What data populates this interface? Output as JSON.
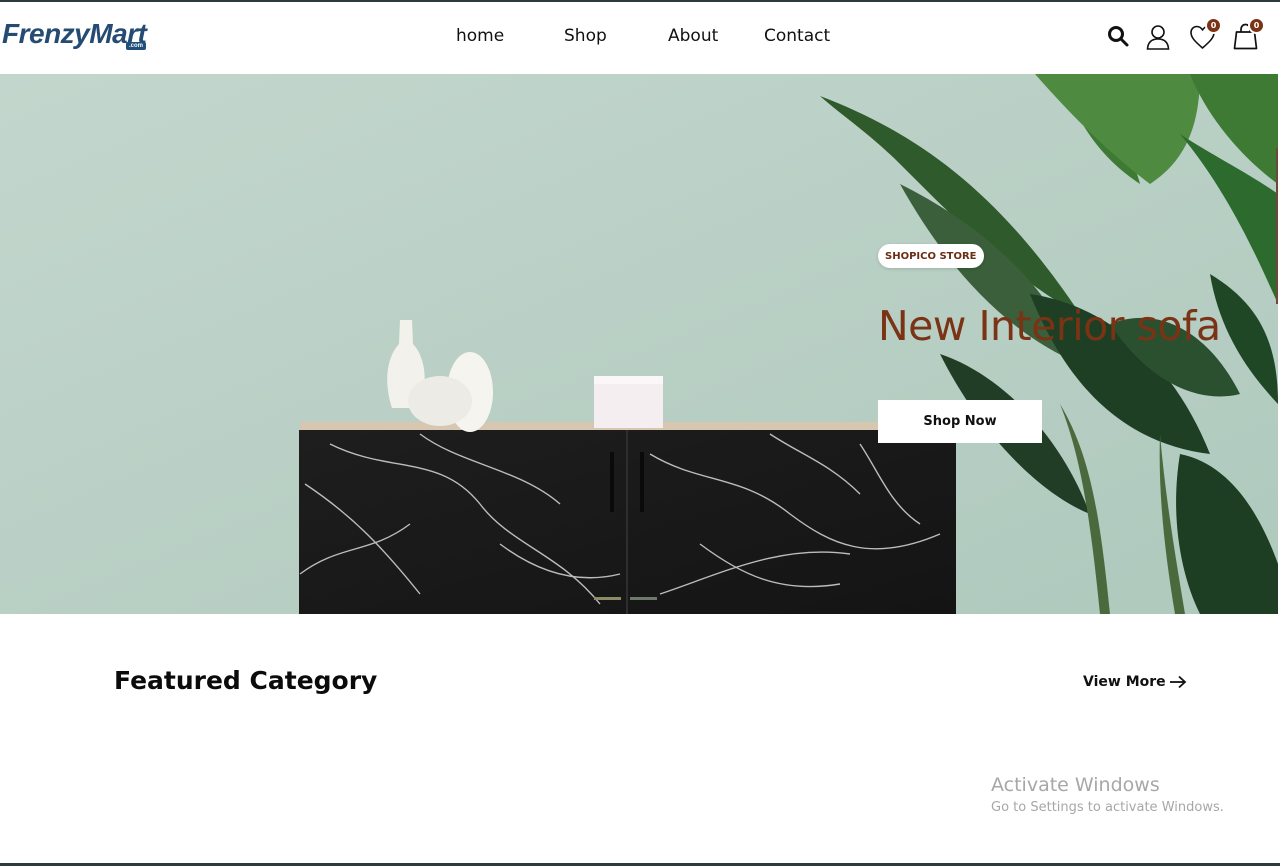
{
  "brand": {
    "name": "FrenzyMart",
    "badge": ".com",
    "accent_color": "#7a3314",
    "logo_color": "#264b73"
  },
  "nav": {
    "items": [
      {
        "label": "home"
      },
      {
        "label": "Shop"
      },
      {
        "label": "About"
      },
      {
        "label": "Contact"
      }
    ]
  },
  "header_actions": {
    "search_icon": "search-icon",
    "account_icon": "user-icon",
    "wishlist_icon": "heart-icon",
    "wishlist_count": "0",
    "cart_icon": "shopping-bag-icon",
    "cart_count": "0"
  },
  "hero": {
    "badge": "SHOPICO STORE",
    "title": "New Interior sofa",
    "cta_label": "Shop Now",
    "slides_total": 2,
    "active_slide": 1
  },
  "featured": {
    "title": "Featured Category",
    "view_more_label": "View More"
  },
  "watermark": {
    "title": "Activate Windows",
    "subtitle": "Go to Settings to activate Windows."
  }
}
